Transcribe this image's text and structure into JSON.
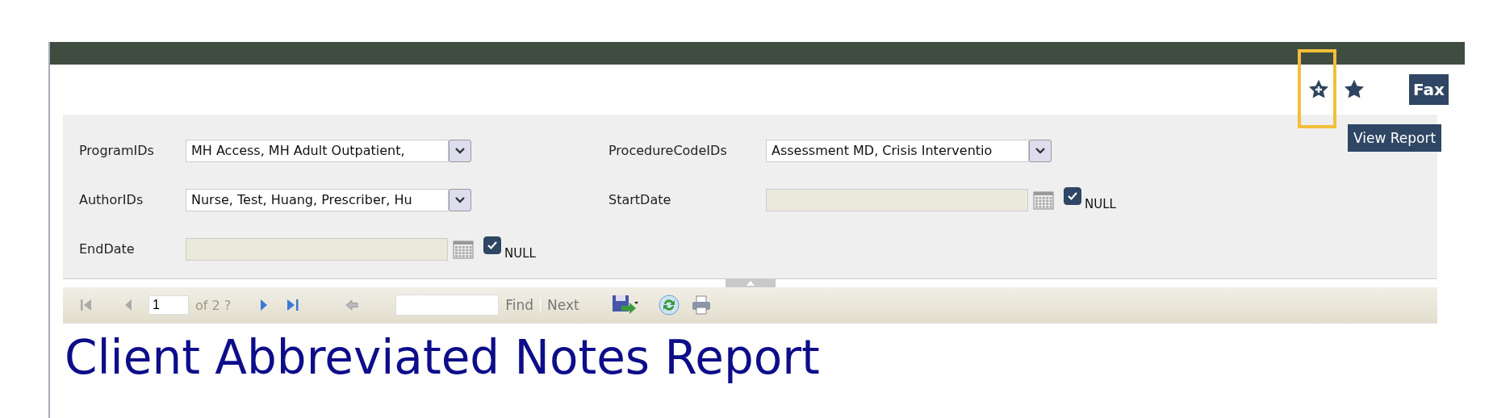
{
  "favorites": [
    {
      "kind": "add",
      "highlighted": true
    },
    {
      "kind": "filled",
      "highlighted": false
    }
  ],
  "fax_button": "Fax",
  "parameters": [
    {
      "label": "ProgramIDs",
      "kind": "multiselect",
      "value": "MH Access, MH Adult Outpatient,"
    },
    {
      "label": "ProcedureCodeIDs",
      "kind": "multiselect",
      "value": "Assessment MD, Crisis Interventio"
    },
    {
      "label": "AuthorIDs",
      "kind": "multiselect",
      "value": "Nurse, Test, Huang, Prescriber, Hu"
    },
    {
      "label": "StartDate",
      "kind": "date",
      "null_checked": true,
      "null_label": "NULL"
    },
    {
      "label": "EndDate",
      "kind": "date",
      "null_checked": true,
      "null_label": "NULL"
    }
  ],
  "view_report_button": "View Report",
  "toolbar": {
    "page": "1",
    "page_count": "of 2 ?",
    "find_label": "Find",
    "next_label": "Next"
  },
  "report_title": "Client Abbreviated Notes Report"
}
